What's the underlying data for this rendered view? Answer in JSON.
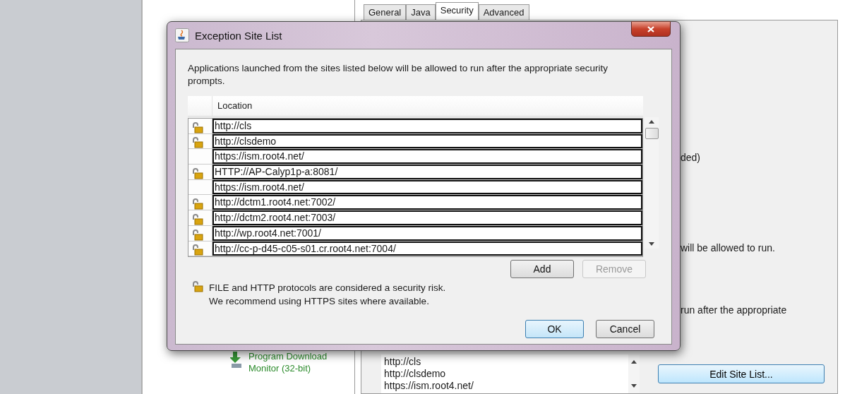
{
  "background": {
    "program_item": {
      "label": "Program Download Monitor (32-bit)"
    },
    "tabs": [
      {
        "label": "General",
        "selected": false
      },
      {
        "label": "Java",
        "selected": false
      },
      {
        "label": "Security",
        "selected": true
      },
      {
        "label": "Advanced",
        "selected": false
      }
    ],
    "text_fragments": [
      "ded)",
      "will be allowed to run.",
      "run after the appropriate"
    ],
    "site_list": [
      "http://cls",
      "http://clsdemo",
      "https://ism.root4.net/"
    ],
    "edit_button": "Edit Site List..."
  },
  "dialog": {
    "title": "Exception Site List",
    "description": "Applications launched from the sites listed below will be allowed to run after the appropriate security prompts.",
    "table": {
      "columns": [
        "Location"
      ],
      "rows": [
        {
          "location": "http://cls",
          "insecure": true
        },
        {
          "location": "http://clsdemo",
          "insecure": true
        },
        {
          "location": "https://ism.root4.net/",
          "insecure": false
        },
        {
          "location": "HTTP://AP-Calyp1p-a:8081/",
          "insecure": true
        },
        {
          "location": "https://ism.root4.net/",
          "insecure": false
        },
        {
          "location": "http://dctm1.root4.net:7002/",
          "insecure": true
        },
        {
          "location": "http://dctm2.root4.net:7003/",
          "insecure": true
        },
        {
          "location": "http://wp.root4.net:7001/",
          "insecure": true
        },
        {
          "location": "http://cc-p-d45-c05-s01.cr.root4.net:7004/",
          "insecure": true
        }
      ]
    },
    "list_buttons": [
      {
        "label": "Add",
        "disabled": false
      },
      {
        "label": "Remove",
        "disabled": true
      }
    ],
    "warning": [
      "FILE and HTTP protocols are considered a security risk.",
      "We recommend using HTTPS sites where available."
    ],
    "footer_buttons": [
      {
        "label": "OK",
        "default": true
      },
      {
        "label": "Cancel",
        "default": false
      }
    ]
  }
}
